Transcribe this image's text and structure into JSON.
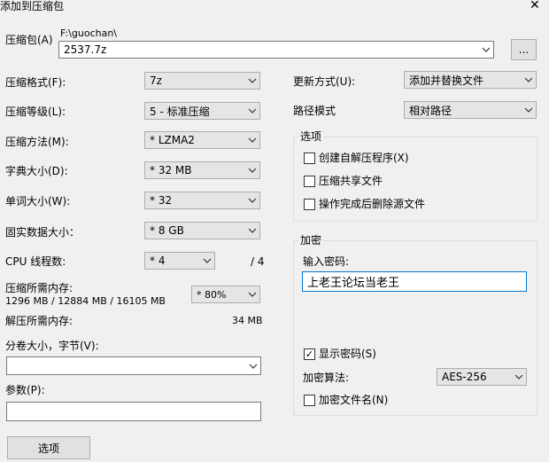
{
  "window": {
    "title": "添加到压缩包",
    "close_glyph": "✕"
  },
  "archive": {
    "label": "压缩包(A)",
    "path_hint": "F:\\guochan\\",
    "name_value": "2537.7z",
    "browse_label": "..."
  },
  "left": {
    "format": {
      "label": "压缩格式(F):",
      "value": "7z"
    },
    "level": {
      "label": "压缩等级(L):",
      "value": "5 - 标准压缩"
    },
    "method": {
      "label": "压缩方法(M):",
      "value": "*  LZMA2"
    },
    "dict": {
      "label": "字典大小(D):",
      "value": "*  32 MB"
    },
    "word": {
      "label": "单词大小(W):",
      "value": "*  32"
    },
    "solid": {
      "label": "固实数据大小：",
      "value": "*  8 GB"
    },
    "threads": {
      "label": "CPU 线程数:",
      "value": "*  4",
      "total": "/ 4"
    },
    "mem_compress": {
      "label": "压缩所需内存:",
      "detail": "1296 MB / 12884 MB / 16105 MB",
      "percent": "*  80%"
    },
    "mem_decompress": {
      "label": "解压所需内存:",
      "value": "34 MB"
    },
    "volume": {
      "label": "分卷大小，字节(V):",
      "value": ""
    },
    "params": {
      "label": "参数(P):",
      "value": ""
    },
    "options_button": "选项"
  },
  "right": {
    "update": {
      "label": "更新方式(U):",
      "value": "添加并替换文件"
    },
    "pathmode": {
      "label": "路径模式",
      "value": "相对路径"
    },
    "options_group": {
      "title": "选项",
      "items": [
        {
          "label": "创建自解压程序(X)",
          "checked": false
        },
        {
          "label": "压缩共享文件",
          "checked": false
        },
        {
          "label": "操作完成后删除源文件",
          "checked": false
        }
      ]
    },
    "encryption": {
      "title": "加密",
      "password_label": "输入密码:",
      "password_value": "上老王论坛当老王",
      "show_password": {
        "label": "显示密码(S)",
        "checked": true
      },
      "method_label": "加密算法:",
      "method_value": "AES-256",
      "encrypt_names": {
        "label": "加密文件名(N)",
        "checked": false
      }
    }
  },
  "icons": {
    "check_glyph": "✓"
  }
}
